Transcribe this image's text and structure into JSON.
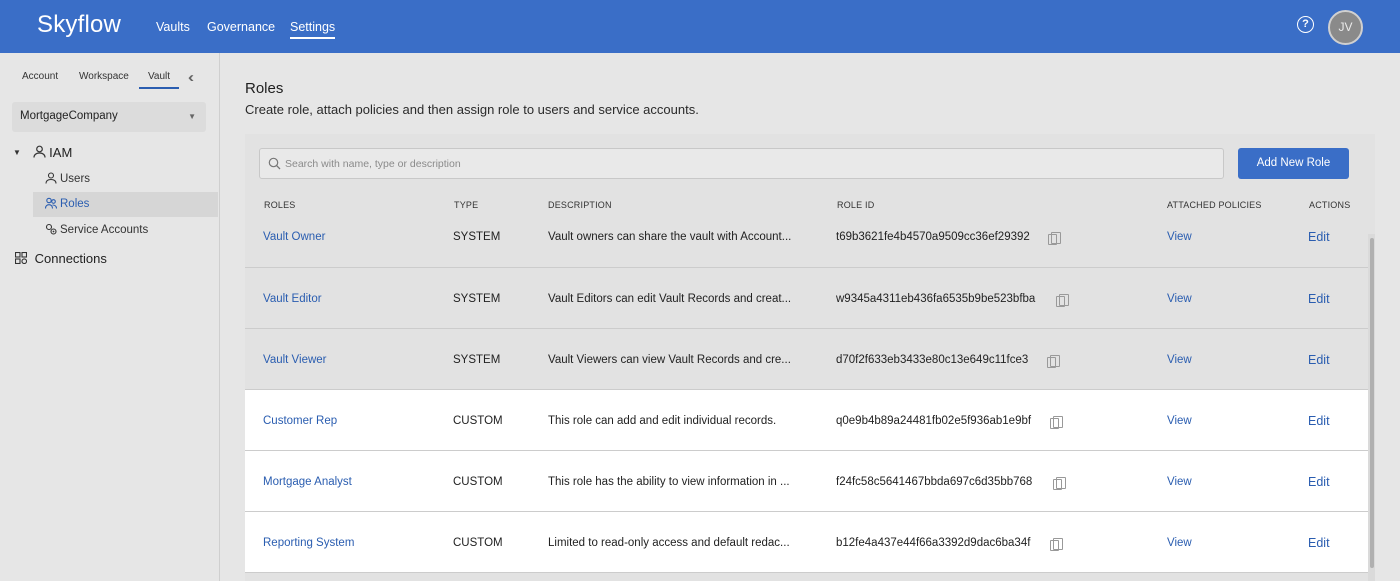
{
  "app": {
    "logo": "Skyflow",
    "nav": [
      "Vaults",
      "Governance",
      "Settings"
    ],
    "user_initials": "JV",
    "help_glyph": "?"
  },
  "sidebar": {
    "tabs": [
      "Account",
      "Workspace",
      "Vault"
    ],
    "vault_select": "MortgageCompany",
    "iam_label": "IAM",
    "iam_items": [
      "Users",
      "Roles",
      "Service Accounts"
    ],
    "connections_label": "Connections"
  },
  "main": {
    "title": "Roles",
    "subtitle": "Create role, attach policies and then assign role to users and service accounts.",
    "search_placeholder": "Search with name, type or description",
    "add_button": "Add New Role",
    "columns": [
      "ROLES",
      "TYPE",
      "DESCRIPTION",
      "ROLE ID",
      "ATTACHED POLICIES",
      "ACTIONS"
    ],
    "rows": [
      {
        "name": "Vault Owner",
        "type": "SYSTEM",
        "description": "Vault owners can share the vault with Account...",
        "role_id": "t69b3621fe4b4570a9509cc36ef29392",
        "view": "View",
        "edit": "Edit"
      },
      {
        "name": "Vault Editor",
        "type": "SYSTEM",
        "description": "Vault Editors can edit Vault Records and creat...",
        "role_id": "w9345a4311eb436fa6535b9be523bfba",
        "view": "View",
        "edit": "Edit"
      },
      {
        "name": "Vault Viewer",
        "type": "SYSTEM",
        "description": "Vault Viewers can view Vault Records and cre...",
        "role_id": "d70f2f633eb3433e80c13e649c11fce3",
        "view": "View",
        "edit": "Edit"
      },
      {
        "name": "Customer Rep",
        "type": "CUSTOM",
        "description": "This role can add and edit individual records.",
        "role_id": "q0e9b4b89a24481fb02e5f936ab1e9bf",
        "view": "View",
        "edit": "Edit"
      },
      {
        "name": "Mortgage Analyst",
        "type": "CUSTOM",
        "description": "This role has the ability to view information in ...",
        "role_id": "f24fc58c5641467bbda697c6d35bb768",
        "view": "View",
        "edit": "Edit"
      },
      {
        "name": "Reporting System",
        "type": "CUSTOM",
        "description": "Limited to read-only access and default redac...",
        "role_id": "b12fe4a437e44f66a3392d9dac6ba34f",
        "view": "View",
        "edit": "Edit"
      }
    ]
  }
}
